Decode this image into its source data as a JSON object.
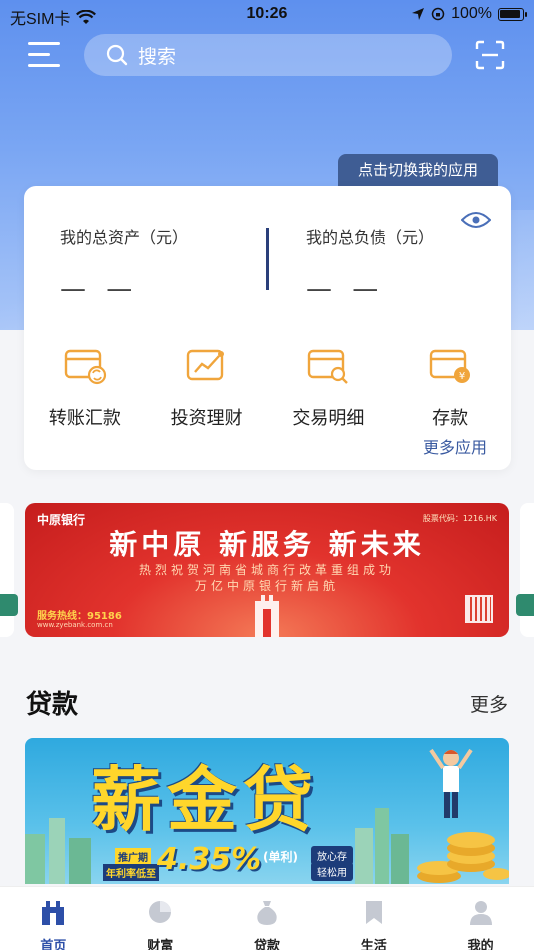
{
  "status_bar": {
    "carrier": "无SIM卡",
    "time": "10:26",
    "battery": "100%"
  },
  "header": {
    "search_label": "搜索"
  },
  "switch_tip": "点击切换我的应用",
  "assets": {
    "total_assets_label": "我的总资产（元）",
    "total_assets_value": "— —",
    "total_debt_label": "我的总负债（元）",
    "total_debt_value": "— —"
  },
  "apps": [
    {
      "label": "转账汇款",
      "icon": "transfer-card-icon"
    },
    {
      "label": "投资理财",
      "icon": "investment-chart-icon"
    },
    {
      "label": "交易明细",
      "icon": "transaction-search-icon"
    },
    {
      "label": "存款",
      "icon": "deposit-card-icon"
    }
  ],
  "more_apps": "更多应用",
  "promo_banner": {
    "logo": "中原银行",
    "stock_code": "股票代码：1216.HK",
    "title": "新中原  新服务  新未来",
    "subtitle1": "热烈祝贺河南省城商行改革重组成功",
    "subtitle2": "万亿中原银行新启航",
    "hotline": "服务热线：95186",
    "url": "www.zyebank.com.cn"
  },
  "loan_section": {
    "title": "贷款",
    "more": "更多"
  },
  "loan_banner": {
    "title": "薪金贷",
    "tag1": "推广期",
    "tag2": "年利率低至",
    "rate": "4.35%",
    "rate_note": "(单利)",
    "badge1": "放心存",
    "badge2": "轻松用"
  },
  "tabbar": [
    {
      "label": "首页",
      "active": true
    },
    {
      "label": "财富",
      "active": false
    },
    {
      "label": "贷款",
      "active": false
    },
    {
      "label": "生活",
      "active": false
    },
    {
      "label": "我的",
      "active": false
    }
  ],
  "colors": {
    "accent": "#2d4fa8",
    "app_icon": "#f0a53c",
    "banner_red": "#e2332d"
  }
}
